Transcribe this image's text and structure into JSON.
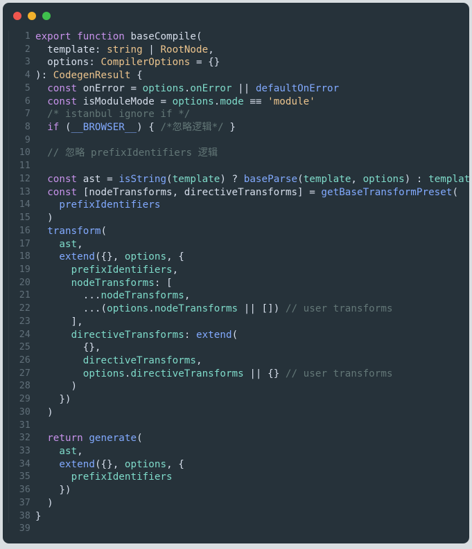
{
  "window": {
    "chrome": {
      "buttons": [
        {
          "name": "close",
          "color": "#f0564e"
        },
        {
          "name": "minimize",
          "color": "#f2b12c"
        },
        {
          "name": "maximize",
          "color": "#3fc14d"
        }
      ]
    },
    "background": "#26323a",
    "page_background": "#d9dee1"
  },
  "editor": {
    "language": "typescript",
    "first_line_number": 1,
    "last_line_number": 39,
    "palette": {
      "keyword": "#c792ea",
      "type": "#ecc48d",
      "string": "#ecc48d",
      "function": "#82aaff",
      "variable": "#7fdbca",
      "plain": "#d6deeb",
      "comment": "#637777",
      "line_number": "#61707a"
    },
    "lines": [
      {
        "n": "1",
        "tokens": [
          {
            "t": "export",
            "c": "kw"
          },
          {
            "t": " ",
            "c": "pln"
          },
          {
            "t": "function",
            "c": "kw"
          },
          {
            "t": " ",
            "c": "pln"
          },
          {
            "t": "baseCompile",
            "c": "pln"
          },
          {
            "t": "(",
            "c": "pln"
          }
        ]
      },
      {
        "n": "2",
        "tokens": [
          {
            "t": "  template",
            "c": "pln"
          },
          {
            "t": ": ",
            "c": "pln"
          },
          {
            "t": "string",
            "c": "typ"
          },
          {
            "t": " | ",
            "c": "pln"
          },
          {
            "t": "RootNode",
            "c": "typ"
          },
          {
            "t": ",",
            "c": "pln"
          }
        ]
      },
      {
        "n": "3",
        "tokens": [
          {
            "t": "  options",
            "c": "pln"
          },
          {
            "t": ": ",
            "c": "pln"
          },
          {
            "t": "CompilerOptions",
            "c": "typ"
          },
          {
            "t": " = {}",
            "c": "pln"
          }
        ]
      },
      {
        "n": "4",
        "tokens": [
          {
            "t": "): ",
            "c": "pln"
          },
          {
            "t": "CodegenResult",
            "c": "typ"
          },
          {
            "t": " {",
            "c": "pln"
          }
        ]
      },
      {
        "n": "5",
        "tokens": [
          {
            "t": "  ",
            "c": "pln"
          },
          {
            "t": "const",
            "c": "kw"
          },
          {
            "t": " onError = ",
            "c": "pln"
          },
          {
            "t": "options",
            "c": "var"
          },
          {
            "t": ".",
            "c": "pln"
          },
          {
            "t": "onError",
            "c": "var"
          },
          {
            "t": " || ",
            "c": "pln"
          },
          {
            "t": "defaultOnError",
            "c": "fn"
          }
        ]
      },
      {
        "n": "6",
        "tokens": [
          {
            "t": "  ",
            "c": "pln"
          },
          {
            "t": "const",
            "c": "kw"
          },
          {
            "t": " isModuleMode = ",
            "c": "pln"
          },
          {
            "t": "options",
            "c": "var"
          },
          {
            "t": ".",
            "c": "pln"
          },
          {
            "t": "mode",
            "c": "var"
          },
          {
            "t": " ≡≡ ",
            "c": "pln"
          },
          {
            "t": "'module'",
            "c": "str"
          }
        ]
      },
      {
        "n": "7",
        "tokens": [
          {
            "t": "  /* istanbul ignore if */",
            "c": "cmt"
          }
        ]
      },
      {
        "n": "8",
        "tokens": [
          {
            "t": "  ",
            "c": "pln"
          },
          {
            "t": "if",
            "c": "kw"
          },
          {
            "t": " (",
            "c": "pln"
          },
          {
            "t": "__BROWSER__",
            "c": "fn"
          },
          {
            "t": ") { ",
            "c": "pln"
          },
          {
            "t": "/*忽略逻辑*/",
            "c": "cmt"
          },
          {
            "t": " }",
            "c": "pln"
          }
        ]
      },
      {
        "n": "9",
        "tokens": []
      },
      {
        "n": "10",
        "tokens": [
          {
            "t": "  // 忽略 prefixIdentifiers 逻辑",
            "c": "cmt"
          }
        ]
      },
      {
        "n": "11",
        "tokens": []
      },
      {
        "n": "12",
        "tokens": [
          {
            "t": "  ",
            "c": "pln"
          },
          {
            "t": "const",
            "c": "kw"
          },
          {
            "t": " ast = ",
            "c": "pln"
          },
          {
            "t": "isString",
            "c": "fn"
          },
          {
            "t": "(",
            "c": "pln"
          },
          {
            "t": "template",
            "c": "var"
          },
          {
            "t": ") ? ",
            "c": "pln"
          },
          {
            "t": "baseParse",
            "c": "fn"
          },
          {
            "t": "(",
            "c": "pln"
          },
          {
            "t": "template",
            "c": "var"
          },
          {
            "t": ", ",
            "c": "pln"
          },
          {
            "t": "options",
            "c": "var"
          },
          {
            "t": ") : ",
            "c": "pln"
          },
          {
            "t": "template",
            "c": "var"
          }
        ]
      },
      {
        "n": "13",
        "tokens": [
          {
            "t": "  ",
            "c": "pln"
          },
          {
            "t": "const",
            "c": "kw"
          },
          {
            "t": " [nodeTransforms, directiveTransforms] = ",
            "c": "pln"
          },
          {
            "t": "getBaseTransformPreset",
            "c": "fn"
          },
          {
            "t": "(",
            "c": "pln"
          }
        ]
      },
      {
        "n": "14",
        "tokens": [
          {
            "t": "    ",
            "c": "pln"
          },
          {
            "t": "prefixIdentifiers",
            "c": "fn"
          }
        ]
      },
      {
        "n": "15",
        "tokens": [
          {
            "t": "  )",
            "c": "pln"
          }
        ]
      },
      {
        "n": "16",
        "tokens": [
          {
            "t": "  ",
            "c": "pln"
          },
          {
            "t": "transform",
            "c": "fn"
          },
          {
            "t": "(",
            "c": "pln"
          }
        ]
      },
      {
        "n": "17",
        "tokens": [
          {
            "t": "    ",
            "c": "pln"
          },
          {
            "t": "ast",
            "c": "var"
          },
          {
            "t": ",",
            "c": "pln"
          }
        ]
      },
      {
        "n": "18",
        "tokens": [
          {
            "t": "    ",
            "c": "pln"
          },
          {
            "t": "extend",
            "c": "fn"
          },
          {
            "t": "({}, ",
            "c": "pln"
          },
          {
            "t": "options",
            "c": "var"
          },
          {
            "t": ", {",
            "c": "pln"
          }
        ]
      },
      {
        "n": "19",
        "tokens": [
          {
            "t": "      ",
            "c": "pln"
          },
          {
            "t": "prefixIdentifiers",
            "c": "var"
          },
          {
            "t": ",",
            "c": "pln"
          }
        ]
      },
      {
        "n": "20",
        "tokens": [
          {
            "t": "      ",
            "c": "pln"
          },
          {
            "t": "nodeTransforms",
            "c": "var"
          },
          {
            "t": ": [",
            "c": "pln"
          }
        ]
      },
      {
        "n": "21",
        "tokens": [
          {
            "t": "        ...",
            "c": "pln"
          },
          {
            "t": "nodeTransforms",
            "c": "var"
          },
          {
            "t": ",",
            "c": "pln"
          }
        ]
      },
      {
        "n": "22",
        "tokens": [
          {
            "t": "        ...(",
            "c": "pln"
          },
          {
            "t": "options",
            "c": "var"
          },
          {
            "t": ".",
            "c": "pln"
          },
          {
            "t": "nodeTransforms",
            "c": "var"
          },
          {
            "t": " || []) ",
            "c": "pln"
          },
          {
            "t": "// user transforms",
            "c": "cmt"
          }
        ]
      },
      {
        "n": "23",
        "tokens": [
          {
            "t": "      ],",
            "c": "pln"
          }
        ]
      },
      {
        "n": "24",
        "tokens": [
          {
            "t": "      ",
            "c": "pln"
          },
          {
            "t": "directiveTransforms",
            "c": "var"
          },
          {
            "t": ": ",
            "c": "pln"
          },
          {
            "t": "extend",
            "c": "fn"
          },
          {
            "t": "(",
            "c": "pln"
          }
        ]
      },
      {
        "n": "25",
        "tokens": [
          {
            "t": "        {},",
            "c": "pln"
          }
        ]
      },
      {
        "n": "26",
        "tokens": [
          {
            "t": "        ",
            "c": "pln"
          },
          {
            "t": "directiveTransforms",
            "c": "var"
          },
          {
            "t": ",",
            "c": "pln"
          }
        ]
      },
      {
        "n": "27",
        "tokens": [
          {
            "t": "        ",
            "c": "pln"
          },
          {
            "t": "options",
            "c": "var"
          },
          {
            "t": ".",
            "c": "pln"
          },
          {
            "t": "directiveTransforms",
            "c": "var"
          },
          {
            "t": " || {} ",
            "c": "pln"
          },
          {
            "t": "// user transforms",
            "c": "cmt"
          }
        ]
      },
      {
        "n": "28",
        "tokens": [
          {
            "t": "      )",
            "c": "pln"
          }
        ]
      },
      {
        "n": "29",
        "tokens": [
          {
            "t": "    })",
            "c": "pln"
          }
        ]
      },
      {
        "n": "30",
        "tokens": [
          {
            "t": "  )",
            "c": "pln"
          }
        ]
      },
      {
        "n": "31",
        "tokens": []
      },
      {
        "n": "32",
        "tokens": [
          {
            "t": "  ",
            "c": "pln"
          },
          {
            "t": "return",
            "c": "kw"
          },
          {
            "t": " ",
            "c": "pln"
          },
          {
            "t": "generate",
            "c": "fn"
          },
          {
            "t": "(",
            "c": "pln"
          }
        ]
      },
      {
        "n": "33",
        "tokens": [
          {
            "t": "    ",
            "c": "pln"
          },
          {
            "t": "ast",
            "c": "var"
          },
          {
            "t": ",",
            "c": "pln"
          }
        ]
      },
      {
        "n": "34",
        "tokens": [
          {
            "t": "    ",
            "c": "pln"
          },
          {
            "t": "extend",
            "c": "fn"
          },
          {
            "t": "({}, ",
            "c": "pln"
          },
          {
            "t": "options",
            "c": "var"
          },
          {
            "t": ", {",
            "c": "pln"
          }
        ]
      },
      {
        "n": "35",
        "tokens": [
          {
            "t": "      ",
            "c": "pln"
          },
          {
            "t": "prefixIdentifiers",
            "c": "var"
          }
        ]
      },
      {
        "n": "36",
        "tokens": [
          {
            "t": "    })",
            "c": "pln"
          }
        ]
      },
      {
        "n": "37",
        "tokens": [
          {
            "t": "  )",
            "c": "pln"
          }
        ]
      },
      {
        "n": "38",
        "tokens": [
          {
            "t": "}",
            "c": "pln"
          }
        ]
      },
      {
        "n": "39",
        "tokens": []
      }
    ]
  }
}
